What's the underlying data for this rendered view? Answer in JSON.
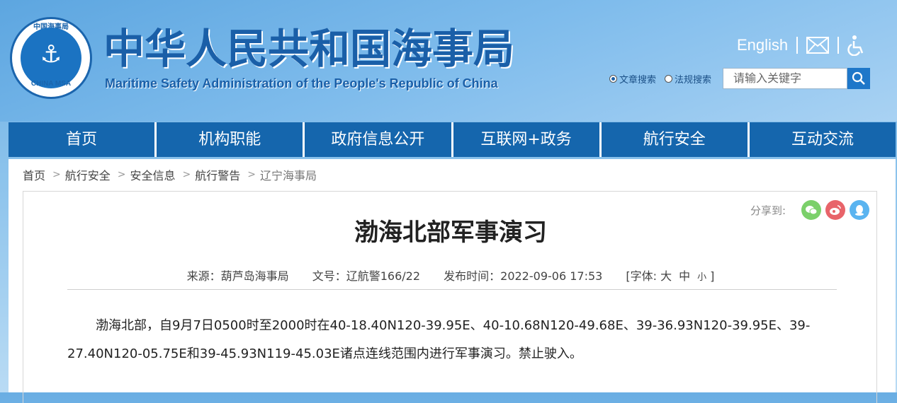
{
  "header": {
    "emblem_top_text": "中国海事局",
    "emblem_bottom_text": "CHINA MSA",
    "title": "中华人民共和国海事局",
    "subtitle": "Maritime Safety Administration of the People's Republic of China"
  },
  "top_links": {
    "english": "English",
    "mail_icon": "mail-icon",
    "accessibility_icon": "wheelchair-icon"
  },
  "search": {
    "options": [
      "文章搜索",
      "法规搜索"
    ],
    "selected": "文章搜索",
    "placeholder": "请输入关键字",
    "button_icon": "search-icon"
  },
  "nav": [
    "首页",
    "机构职能",
    "政府信息公开",
    "互联网+政务",
    "航行安全",
    "互动交流"
  ],
  "breadcrumb": [
    "首页",
    "航行安全",
    "安全信息",
    "航行警告",
    "辽宁海事局"
  ],
  "share": {
    "label": "分享到:",
    "icons": [
      "wechat-icon",
      "weibo-icon",
      "qq-icon"
    ]
  },
  "article": {
    "title": "渤海北部军事演习",
    "source": "来源：葫芦岛海事局",
    "doc_no": "文号：辽航警166/22",
    "published": "发布时间：2022-09-06 17:53",
    "font_label": "[字体:",
    "font_large": "大",
    "font_medium": "中",
    "font_small": "小",
    "font_close": "]",
    "body": "渤海北部，自9月7日0500时至2000时在40-18.40N120-39.95E、40-10.68N120-49.68E、39-36.93N120-39.95E、39-27.40N120-05.75E和39-45.93N119-45.03E诸点连线范围内进行军事演习。禁止驶入。"
  },
  "colors": {
    "brand": "#1566ad",
    "title_blue": "#1a5fa8",
    "wechat": "#7bd06a",
    "weibo": "#e8646a",
    "qq": "#5ab4f0"
  }
}
